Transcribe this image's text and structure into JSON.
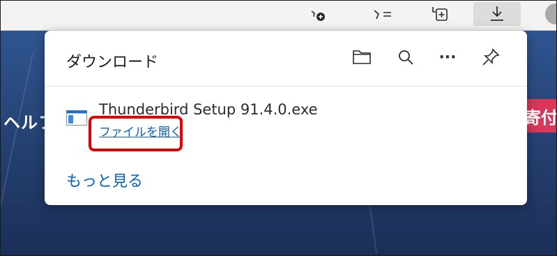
{
  "toolbar": {
    "icons": [
      "favorites-add-icon",
      "favorites-icon",
      "collections-icon",
      "download-icon",
      "profile-avatar"
    ]
  },
  "page": {
    "heading_partial": "ヘルフ",
    "donate_partial": "寄付"
  },
  "downloads": {
    "title": "ダウンロード",
    "header_icons": [
      "open-folder-icon",
      "search-icon",
      "more-options-icon",
      "pin-icon"
    ],
    "more_options_glyph": "···",
    "items": [
      {
        "file_name": "Thunderbird Setup 91.4.0.exe",
        "action_label": "ファイルを開く"
      }
    ],
    "see_more_label": "もっと見る"
  },
  "colors": {
    "accent_link": "#0b63b5",
    "highlight_box": "#e10000",
    "donate": "#d9385a"
  }
}
